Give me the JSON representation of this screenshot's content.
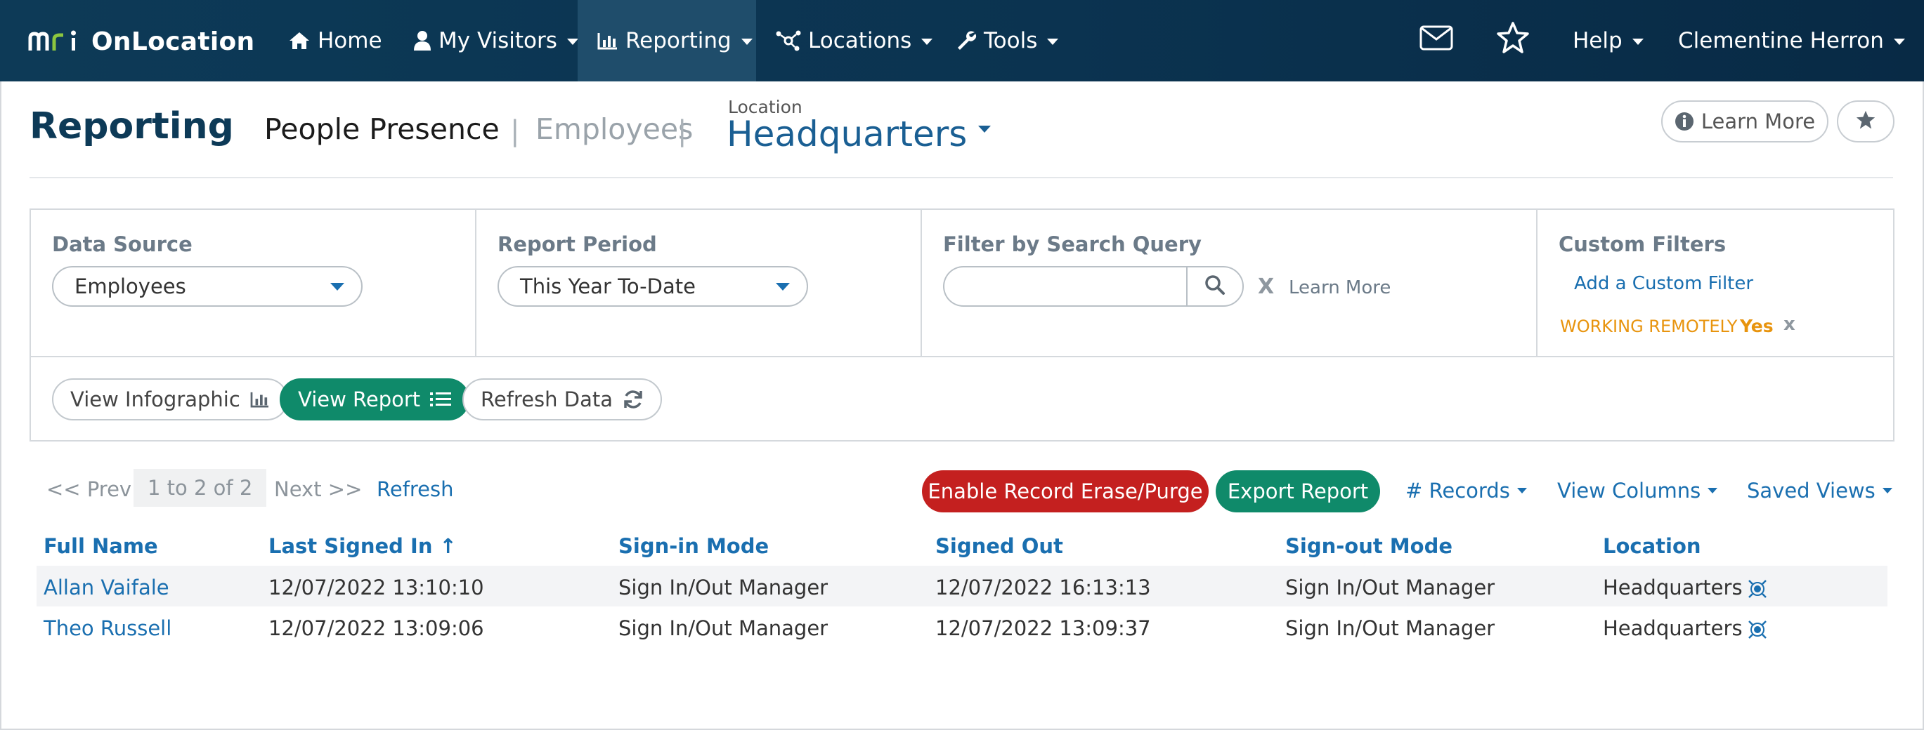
{
  "nav": {
    "brand_logo": "mri",
    "brand_name": "OnLocation",
    "home": "Home",
    "my_visitors": "My Visitors",
    "reporting": "Reporting",
    "locations": "Locations",
    "tools": "Tools",
    "help": "Help",
    "user": "Clementine Herron"
  },
  "header": {
    "title": "Reporting",
    "section": "People Presence",
    "subsection": "Employees",
    "separator": "|",
    "location_label": "Location",
    "location_value": "Headquarters",
    "learn_more": "Learn More"
  },
  "filters": {
    "data_source_label": "Data Source",
    "data_source_value": "Employees",
    "report_period_label": "Report Period",
    "report_period_value": "This Year To-Date",
    "search_label": "Filter by Search Query",
    "search_value": "",
    "search_clear": "X",
    "search_learn_more": "Learn More",
    "custom_label": "Custom Filters",
    "custom_add": "Add a Custom Filter",
    "custom_filter_key": "WORKING REMOTELY",
    "custom_filter_value": "Yes",
    "custom_filter_remove": "x"
  },
  "actions": {
    "view_infographic": "View Infographic",
    "view_report": "View Report",
    "refresh_data": "Refresh Data"
  },
  "results": {
    "prev": "<< Prev",
    "range": "1 to 2 of 2",
    "next": "Next >>",
    "refresh": "Refresh",
    "enable_erase": "Enable Record Erase/Purge",
    "export": "Export Report",
    "records": "# Records",
    "view_columns": "View Columns",
    "saved_views": "Saved Views"
  },
  "table": {
    "columns": [
      "Full Name",
      "Last Signed In ↑",
      "Sign-in Mode",
      "Signed Out",
      "Sign-out Mode",
      "Location"
    ],
    "rows": [
      [
        "Allan Vaifale",
        "12/07/2022 13:10:10",
        "Sign In/Out Manager",
        "12/07/2022 16:13:13",
        "Sign In/Out Manager",
        "Headquarters"
      ],
      [
        "Theo Russell",
        "12/07/2022 13:09:06",
        "Sign In/Out Manager",
        "12/07/2022 13:09:37",
        "Sign In/Out Manager",
        "Headquarters"
      ]
    ]
  },
  "colors": {
    "navbar": "#0d3a57",
    "accent_blue": "#1a6fb0",
    "green": "#0f8a6a",
    "red": "#c4201f",
    "orange": "#e8940e"
  }
}
